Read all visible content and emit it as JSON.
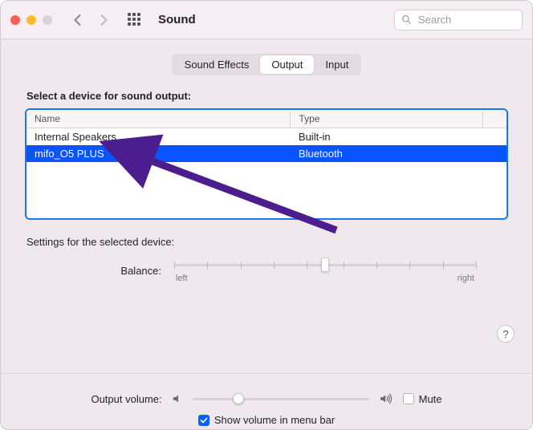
{
  "window": {
    "title": "Sound"
  },
  "search": {
    "placeholder": "Search"
  },
  "tabs": [
    {
      "id": "sound-effects",
      "label": "Sound Effects",
      "active": false
    },
    {
      "id": "output",
      "label": "Output",
      "active": true
    },
    {
      "id": "input",
      "label": "Input",
      "active": false
    }
  ],
  "output": {
    "select_label": "Select a device for sound output:",
    "columns": {
      "name": "Name",
      "type": "Type"
    },
    "devices": [
      {
        "name": "Internal Speakers",
        "type": "Built-in",
        "selected": false
      },
      {
        "name": "mifo_O5 PLUS",
        "type": "Bluetooth",
        "selected": true
      }
    ],
    "settings_label": "Settings for the selected device:",
    "balance": {
      "label": "Balance:",
      "left_label": "left",
      "right_label": "right",
      "value_percent": 50
    }
  },
  "footer": {
    "output_volume_label": "Output volume:",
    "output_volume_percent": 26,
    "mute": {
      "label": "Mute",
      "checked": false
    },
    "show_in_menu_bar": {
      "label": "Show volume in menu bar",
      "checked": true
    }
  },
  "help": {
    "label": "?"
  },
  "annotation": {
    "type": "arrow",
    "color": "#4b1d8e",
    "points_to": "selected output device row"
  }
}
